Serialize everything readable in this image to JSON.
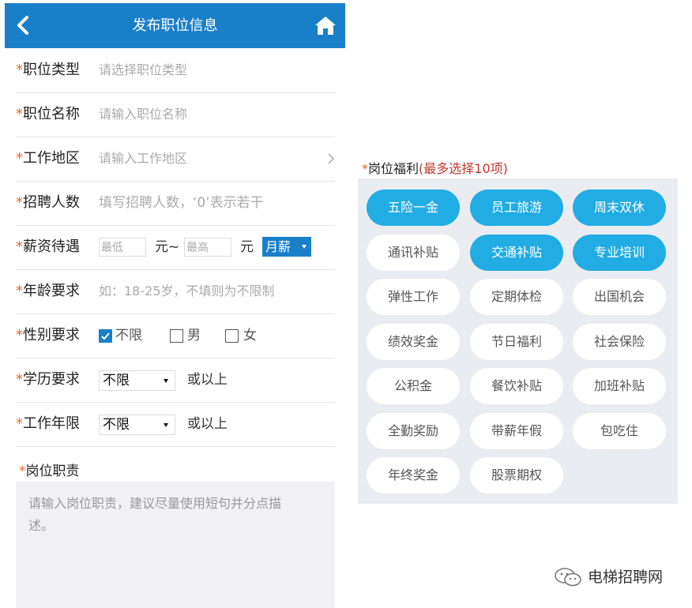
{
  "header": {
    "title": "发布职位信息"
  },
  "form": {
    "job_type": {
      "label": "职位类型",
      "placeholder": "请选择职位类型"
    },
    "job_name": {
      "label": "职位名称",
      "placeholder": "请输入职位名称"
    },
    "work_area": {
      "label": "工作地区",
      "placeholder": "请输入工作地区"
    },
    "headcount": {
      "label": "招聘人数",
      "placeholder": "填写招聘人数，‘0’表示若干"
    },
    "salary": {
      "label": "薪资待遇",
      "min_placeholder": "最低",
      "sep": "元~",
      "max_placeholder": "最高",
      "unit": "元",
      "period": "月薪"
    },
    "age": {
      "label": "年龄要求",
      "placeholder": "如：18-25岁，不填则为不限制"
    },
    "gender": {
      "label": "性别要求",
      "options": [
        "不限",
        "男",
        "女"
      ],
      "selected": "不限"
    },
    "education": {
      "label": "学历要求",
      "value": "不限",
      "suffix": "或以上"
    },
    "experience": {
      "label": "工作年限",
      "value": "不限",
      "suffix": "或以上"
    },
    "duties": {
      "label": "岗位职责",
      "placeholder_line1": "请输入岗位职责，建议尽量使用短句并分点描",
      "placeholder_line2": "述。"
    },
    "required_mark": "*"
  },
  "benefits": {
    "label": "岗位福利",
    "hint": "(最多选择10项)",
    "items": [
      {
        "label": "五险一金",
        "selected": true
      },
      {
        "label": "员工旅游",
        "selected": true
      },
      {
        "label": "周末双休",
        "selected": true
      },
      {
        "label": "通讯补贴",
        "selected": false
      },
      {
        "label": "交通补贴",
        "selected": true
      },
      {
        "label": "专业培训",
        "selected": true
      },
      {
        "label": "弹性工作",
        "selected": false
      },
      {
        "label": "定期体检",
        "selected": false
      },
      {
        "label": "出国机会",
        "selected": false
      },
      {
        "label": "绩效奖金",
        "selected": false
      },
      {
        "label": "节日福利",
        "selected": false
      },
      {
        "label": "社会保险",
        "selected": false
      },
      {
        "label": "公积金",
        "selected": false
      },
      {
        "label": "餐饮补贴",
        "selected": false
      },
      {
        "label": "加班补贴",
        "selected": false
      },
      {
        "label": "全勤奖励",
        "selected": false
      },
      {
        "label": "带薪年假",
        "selected": false
      },
      {
        "label": "包吃住",
        "selected": false
      },
      {
        "label": "年终奖金",
        "selected": false
      },
      {
        "label": "股票期权",
        "selected": false
      }
    ]
  },
  "watermark": {
    "text": "电梯招聘网"
  },
  "colors": {
    "primary": "#1a7fc9",
    "pill_active": "#21ace3",
    "required": "#e06a2a",
    "hint": "#c0392b"
  },
  "icons": {
    "back": "chevron-left-icon",
    "home": "home-icon",
    "arrow": "chevron-right-icon",
    "wechat": "wechat-icon"
  }
}
